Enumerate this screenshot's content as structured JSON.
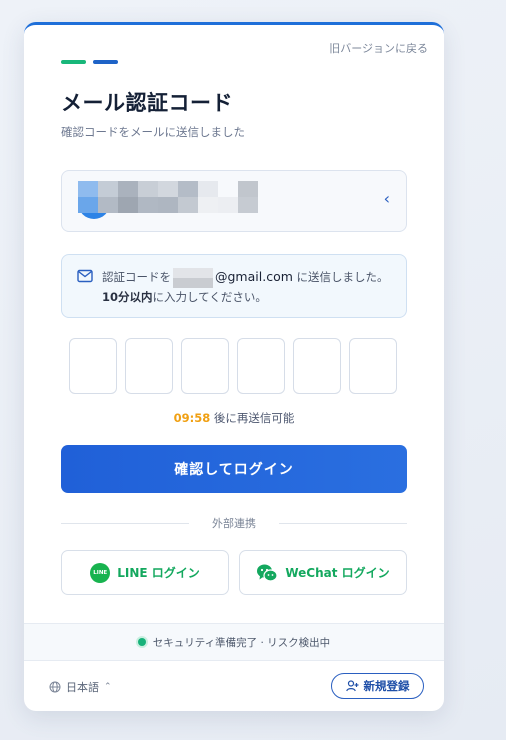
{
  "header": {
    "back_link": "旧バージョンに戻る",
    "title": "メール認証コード",
    "subtitle": "確認コードをメールに送信しました"
  },
  "account": {
    "expand_icon": "chevron-left-icon"
  },
  "notice": {
    "icon": "mail-icon",
    "prefix": "認証コードを",
    "email_domain": "@gmail.com",
    "suffix": " に送信しました。",
    "limit": "10分以内",
    "tail": "に入力してください。"
  },
  "otp": {
    "cells": [
      "",
      "",
      "",
      "",
      "",
      ""
    ]
  },
  "timer": {
    "time": "09:58",
    "label": " 後に再送信可能"
  },
  "actions": {
    "confirm_label": "確認してログイン"
  },
  "social": {
    "divider_label": "外部連携",
    "line_label": "LINE ログイン",
    "line_icon_text": "LINE",
    "wechat_label": "WeChat ログイン"
  },
  "status": {
    "text": "セキュリティ準備完了 · リスク検出中"
  },
  "footer": {
    "language": "日本語",
    "register_label": "新規登録"
  },
  "colors": {
    "primary": "#2563d9",
    "accent_green": "#18b77a",
    "timer": "#f0a013",
    "line_green": "#18b34f"
  }
}
